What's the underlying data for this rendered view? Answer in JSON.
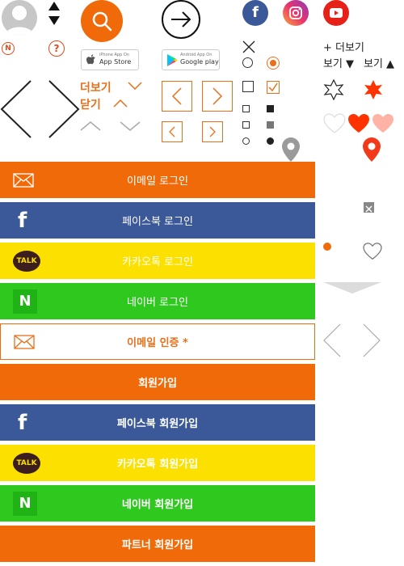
{
  "top_links": {
    "badge_n": "N",
    "badge_q": "?"
  },
  "stores": {
    "appstore_small": "iPhone App On",
    "appstore_big": "App Store",
    "gplay_small": "Android App On",
    "gplay_big": "Google play"
  },
  "toggles": {
    "more": "더보기",
    "close": "닫기"
  },
  "right_panel": {
    "plus_more": "+ 더보기",
    "view_down": "보기 ▼",
    "view_up": "보기 ▲"
  },
  "buttons": {
    "email_login": "이메일 로그인",
    "facebook_login": "페이스북 로그인",
    "kakao_login": "카카오톡 로그인",
    "naver_login": "네이버 로그인",
    "email_verify": "이메일 인증 *",
    "signup": "회원가입",
    "facebook_signup": "페이스북 회원가입",
    "kakao_signup": "카카오톡 회원가입",
    "naver_signup": "네이버 회원가입",
    "partner_signup": "파트너 회원가입"
  },
  "icon_text": {
    "kakao_talk": "TALK",
    "naver_n": "N",
    "facebook_f": "f"
  },
  "colors": {
    "orange": "#f06a0a",
    "facebook": "#3b5998",
    "kakao": "#fbe000",
    "naver": "#2ec81f",
    "heart_red": "#ff3300",
    "heart_pink": "#ffb3a6"
  }
}
